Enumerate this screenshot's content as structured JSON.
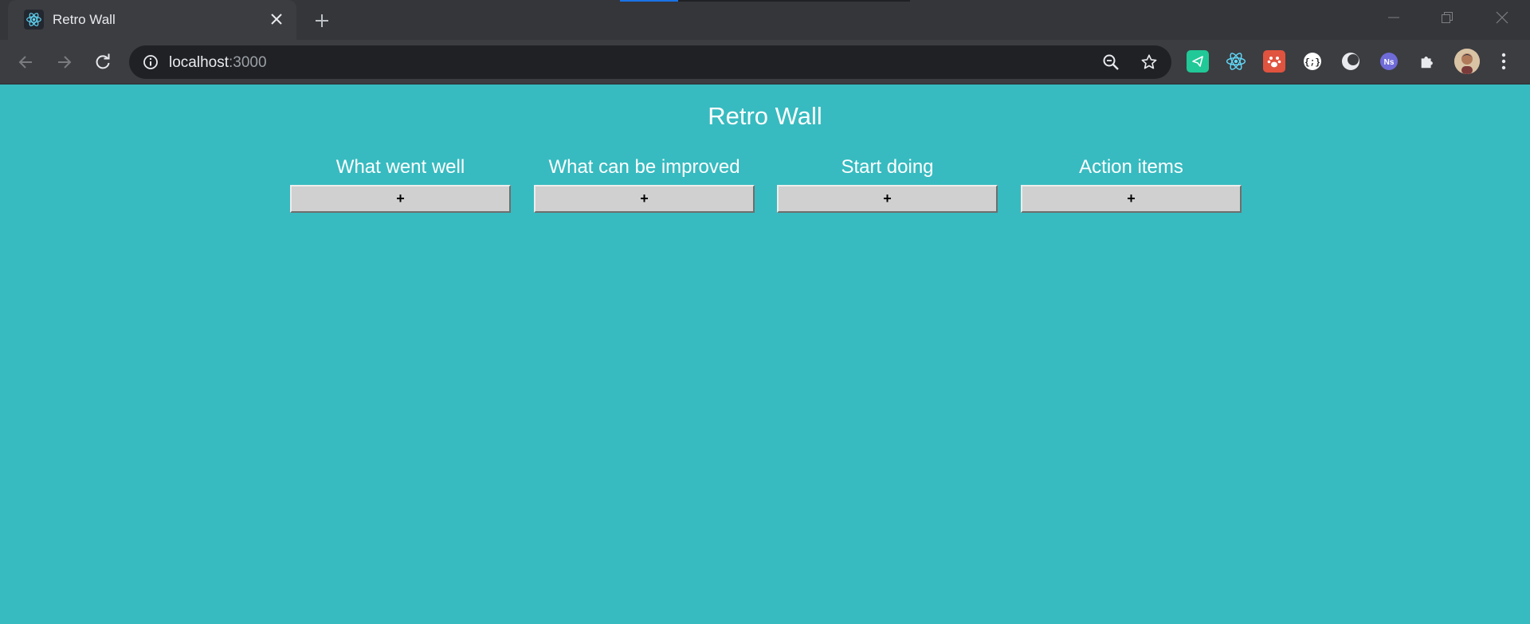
{
  "browser": {
    "tab_title": "Retro Wall",
    "url_host": "localhost",
    "url_port": ":3000",
    "accent_color": "#1a73e8"
  },
  "extensions": [
    {
      "name": "telegram-extension-icon",
      "color": "#20c997"
    },
    {
      "name": "react-devtools-icon",
      "color": "#61dafb"
    },
    {
      "name": "paw-extension-icon",
      "color": "#e0533f"
    },
    {
      "name": "braces-extension-icon",
      "color": "#ffffff"
    },
    {
      "name": "moon-extension-icon",
      "color": "#e8eaed"
    },
    {
      "name": "ns-extension-icon",
      "color": "#6f6bd8"
    },
    {
      "name": "puzzle-extensions-icon",
      "color": "#e8eaed"
    },
    {
      "name": "profile-avatar",
      "color": "#c89a7a"
    }
  ],
  "page": {
    "background": "#37bbc0",
    "title": "Retro Wall",
    "columns": [
      {
        "title": "What went well",
        "add_label": "+"
      },
      {
        "title": "What can be improved",
        "add_label": "+"
      },
      {
        "title": "Start doing",
        "add_label": "+"
      },
      {
        "title": "Action items",
        "add_label": "+"
      }
    ]
  }
}
